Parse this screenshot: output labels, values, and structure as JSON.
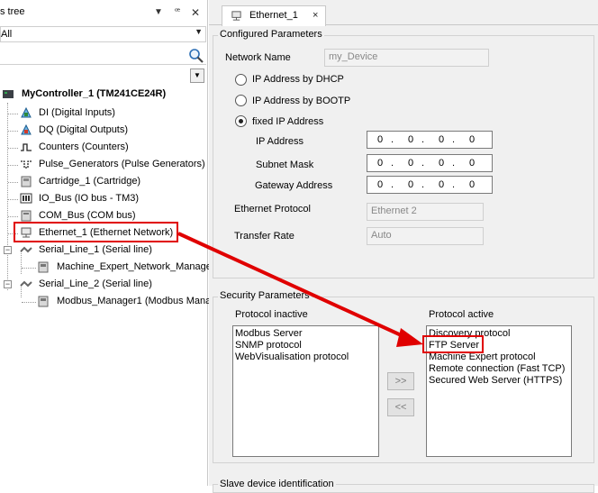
{
  "left": {
    "title": "s tree",
    "filter_value": "All",
    "tree": {
      "root": "MyController_1 (TM241CE24R)",
      "items": [
        "DI (Digital Inputs)",
        "DQ (Digital Outputs)",
        "Counters (Counters)",
        "Pulse_Generators (Pulse Generators)",
        "Cartridge_1 (Cartridge)",
        "IO_Bus (IO bus - TM3)",
        "COM_Bus (COM bus)",
        "Ethernet_1 (Ethernet Network)",
        "Serial_Line_1 (Serial line)",
        "Machine_Expert_Network_Manage",
        "Serial_Line_2 (Serial line)",
        "Modbus_Manager1 (Modbus Mana"
      ]
    }
  },
  "tab": {
    "label": "Ethernet_1",
    "close": "×"
  },
  "configured": {
    "title": "Configured Parameters",
    "network_name_label": "Network Name",
    "network_name_value": "my_Device",
    "radio_dhcp": "IP Address by DHCP",
    "radio_bootp": "IP Address by BOOTP",
    "radio_fixed": "fixed IP Address",
    "ip_label": "IP Address",
    "subnet_label": "Subnet Mask",
    "gateway_label": "Gateway Address",
    "ip": [
      "0",
      "0",
      "0",
      "0"
    ],
    "subnet": [
      "0",
      "0",
      "0",
      "0"
    ],
    "gateway": [
      "0",
      "0",
      "0",
      "0"
    ],
    "protocol_label": "Ethernet Protocol",
    "protocol_value": "Ethernet 2",
    "rate_label": "Transfer Rate",
    "rate_value": "Auto"
  },
  "security": {
    "title": "Security Parameters",
    "inactive_label": "Protocol inactive",
    "active_label": "Protocol active",
    "inactive": [
      "Modbus Server",
      "SNMP protocol",
      "WebVisualisation protocol"
    ],
    "active": [
      "Discovery protocol",
      "FTP Server",
      "Machine Expert protocol",
      "Remote connection (Fast TCP)",
      "Secured Web Server (HTTPS)"
    ],
    "btn_add": ">>",
    "btn_remove": "<<"
  },
  "slave": {
    "title": "Slave device identification"
  },
  "colors": {
    "highlight": "#e00000",
    "panel_bg": "#f0f0f0"
  }
}
